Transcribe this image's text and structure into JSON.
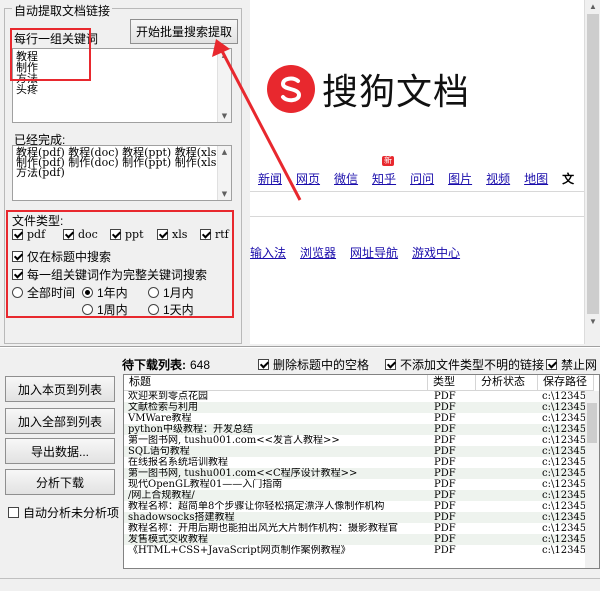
{
  "group": {
    "title": "自动提取文档链接",
    "keywords_label": "每行一组关键词",
    "batch_button": "开始批量搜索提取",
    "keywords": [
      "教程",
      "制作",
      "方法",
      "头疼"
    ],
    "done_label": "已经完成:",
    "done_lines": [
      "教程(pdf) 教程(doc) 教程(ppt) 教程(xls)",
      "制作(pdf) 制作(doc) 制作(ppt) 制作(xls)",
      "方法(pdf)"
    ],
    "filetype_label": "文件类型:",
    "filetypes": [
      {
        "label": "pdf",
        "checked": true
      },
      {
        "label": "doc",
        "checked": true
      },
      {
        "label": "ppt",
        "checked": true
      },
      {
        "label": "xls",
        "checked": true
      },
      {
        "label": "rtf",
        "checked": true
      }
    ],
    "title_only": {
      "label": "仅在标题中搜索",
      "checked": true
    },
    "full_keyword": {
      "label": "每一组关键词作为完整关键词搜索",
      "checked": true
    },
    "time_options": [
      {
        "label": "全部时间",
        "checked": false
      },
      {
        "label": "1年内",
        "checked": true
      },
      {
        "label": "1月内",
        "checked": false
      },
      {
        "label": "1周内",
        "checked": false
      },
      {
        "label": "1天内",
        "checked": false
      }
    ]
  },
  "browser": {
    "logo_text": "搜狗文档",
    "nav": [
      "新闻",
      "网页",
      "微信",
      "知乎",
      "问问",
      "图片",
      "视频",
      "地图",
      "文"
    ],
    "nav_badge": "新",
    "links": [
      "输入法",
      "浏览器",
      "网址导航",
      "游戏中心"
    ]
  },
  "bottom": {
    "pending_label": "待下载列表:",
    "pending_count": "648",
    "opt_remove_space": "删除标题中的空格",
    "opt_no_unknown": "不添加文件类型不明的链接",
    "opt_ban": "禁止网",
    "buttons": {
      "add_page": "加入本页到列表",
      "add_all": "加入全部到列表",
      "export": "导出数据...",
      "analyze": "分析下载"
    },
    "auto_analyze": "自动分析未分析项",
    "columns": [
      "标题",
      "类型",
      "分析状态",
      "保存路径"
    ],
    "rows": [
      [
        "欢迎来到零点花园",
        "PDF",
        "",
        "c:\\12345\\1"
      ],
      [
        "文献检索与利用",
        "PDF",
        "",
        "c:\\12345\\1"
      ],
      [
        "VMWare教程",
        "PDF",
        "",
        "c:\\12345\\1"
      ],
      [
        "python中级教程：开发总结",
        "PDF",
        "",
        "c:\\12345\\1"
      ],
      [
        "第一图书网, tushu001.com<<发言人教程>>",
        "PDF",
        "",
        "c:\\12345\\1"
      ],
      [
        "SQL语句教程",
        "PDF",
        "",
        "c:\\12345\\1"
      ],
      [
        "在线报名系统培训教程",
        "PDF",
        "",
        "c:\\12345\\1"
      ],
      [
        "第一图书网, tushu001.com<<C程序设计教程>>",
        "PDF",
        "",
        "c:\\12345\\1"
      ],
      [
        "现代OpenGL教程01——入门指南",
        "PDF",
        "",
        "c:\\12345\\1"
      ],
      [
        "/网上合规教程/",
        "PDF",
        "",
        "c:\\12345\\1"
      ],
      [
        "教程名称：超简单8个步骤让你轻松搞定漂浮人像制作机构",
        "PDF",
        "",
        "c:\\12345\\1"
      ],
      [
        "shadowsocks搭建教程",
        "PDF",
        "",
        "c:\\12345\\1"
      ],
      [
        "教程名称：开用后期也能拍出风光大片制作机构：摄影教程官",
        "PDF",
        "",
        "c:\\12345\\1"
      ],
      [
        "发售模式交收教程",
        "PDF",
        "",
        "c:\\12345\\1"
      ],
      [
        "《HTML+CSS+JavaScript网页制作案例教程》",
        "PDF",
        "",
        "c:\\12345\\1"
      ]
    ]
  },
  "colors": {
    "highlight": "#e8282e",
    "link": "#1a0dab",
    "row_alt": "#eef3ee"
  }
}
